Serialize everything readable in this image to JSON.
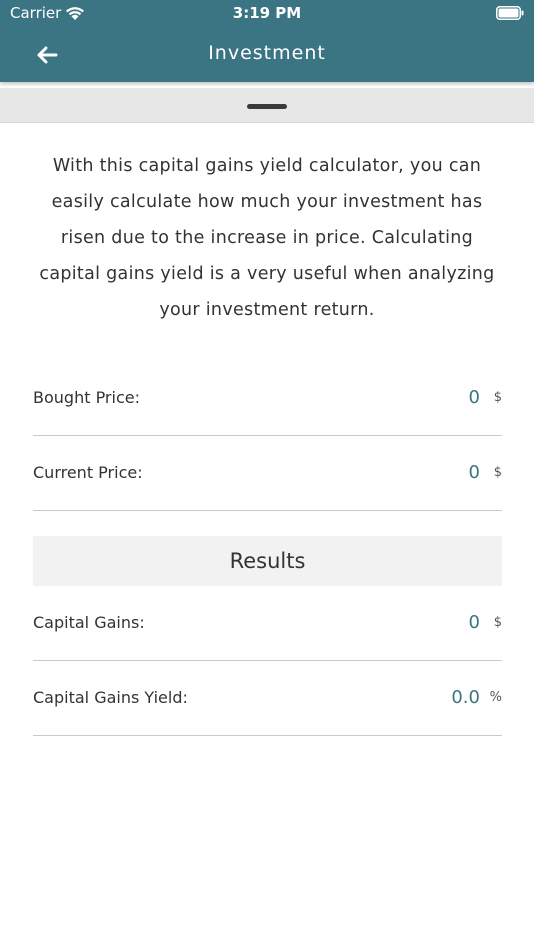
{
  "status_bar": {
    "carrier": "Carrier",
    "time": "3:19 PM"
  },
  "nav": {
    "title": "Investment",
    "back_icon": "arrow-left-icon"
  },
  "intro_text": "With this capital gains yield calculator, you can easily calculate how much your investment has risen due to the increase in price. Calculating capital gains yield is a very useful when analyzing your investment return.",
  "inputs": [
    {
      "label": "Bought Price:",
      "value": "0",
      "unit": "$"
    },
    {
      "label": "Current Price:",
      "value": "0",
      "unit": "$"
    }
  ],
  "results": {
    "title": "Results",
    "rows": [
      {
        "label": "Capital Gains:",
        "value": "0",
        "unit": "$"
      },
      {
        "label": "Capital Gains Yield:",
        "value": "0.0",
        "unit": "%"
      }
    ]
  },
  "colors": {
    "header": "#3b7482",
    "accent": "#3b7482"
  }
}
